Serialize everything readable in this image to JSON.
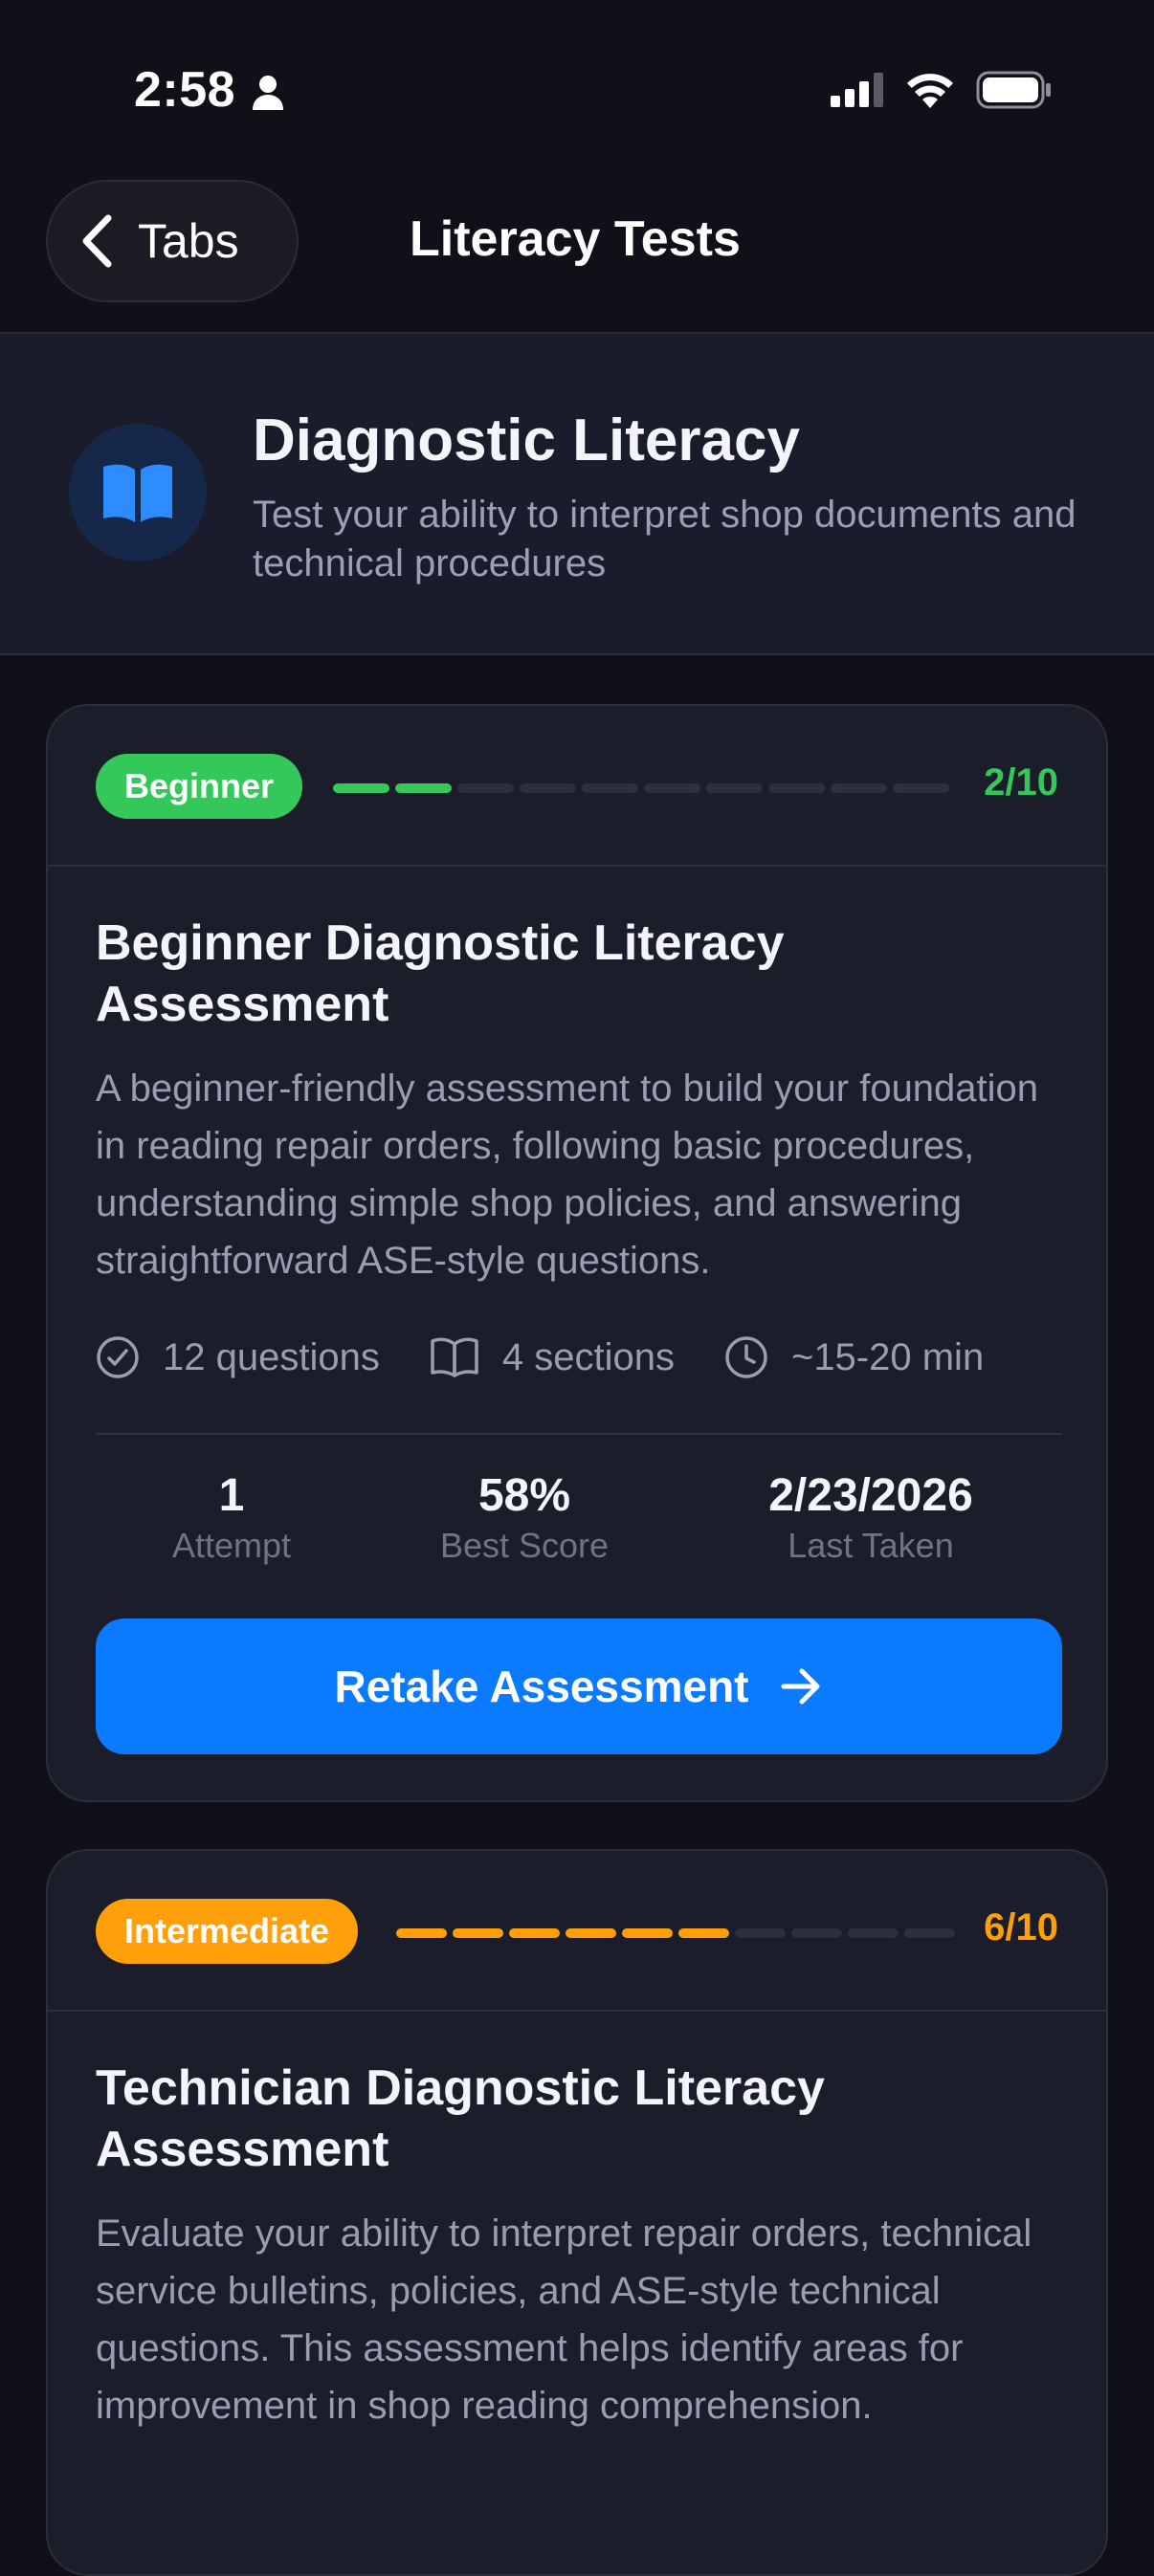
{
  "status_bar": {
    "time": "2:58"
  },
  "nav": {
    "back_label": "Tabs",
    "title": "Literacy Tests"
  },
  "header": {
    "title": "Diagnostic Literacy",
    "subtitle": "Test your ability to interpret shop documents and technical procedures"
  },
  "colors": {
    "beginner": "#34c759",
    "intermediate": "#ff9f0a",
    "primary": "#0a7aff"
  },
  "cards": [
    {
      "badge": "Beginner",
      "progress_text": "2/10",
      "progress_filled": 2,
      "progress_total": 10,
      "title": "Beginner Diagnostic Literacy Assessment",
      "description": "A beginner-friendly assessment to build your foundation in reading repair orders, following basic procedures, understanding simple shop policies, and answering straightforward ASE-style questions.",
      "meta": {
        "questions": "12 questions",
        "sections": "4 sections",
        "duration": "~15-20 min"
      },
      "stats": {
        "attempts_value": "1",
        "attempts_label": "Attempt",
        "best_value": "58%",
        "best_label": "Best Score",
        "last_value": "2/23/2026",
        "last_label": "Last Taken"
      },
      "cta_label": "Retake Assessment"
    },
    {
      "badge": "Intermediate",
      "progress_text": "6/10",
      "progress_filled": 6,
      "progress_total": 10,
      "title": "Technician Diagnostic Literacy Assessment",
      "description": "Evaluate your ability to interpret repair orders, technical service bulletins, policies, and ASE-style technical questions. This assessment helps identify areas for improvement in shop reading comprehension."
    }
  ]
}
